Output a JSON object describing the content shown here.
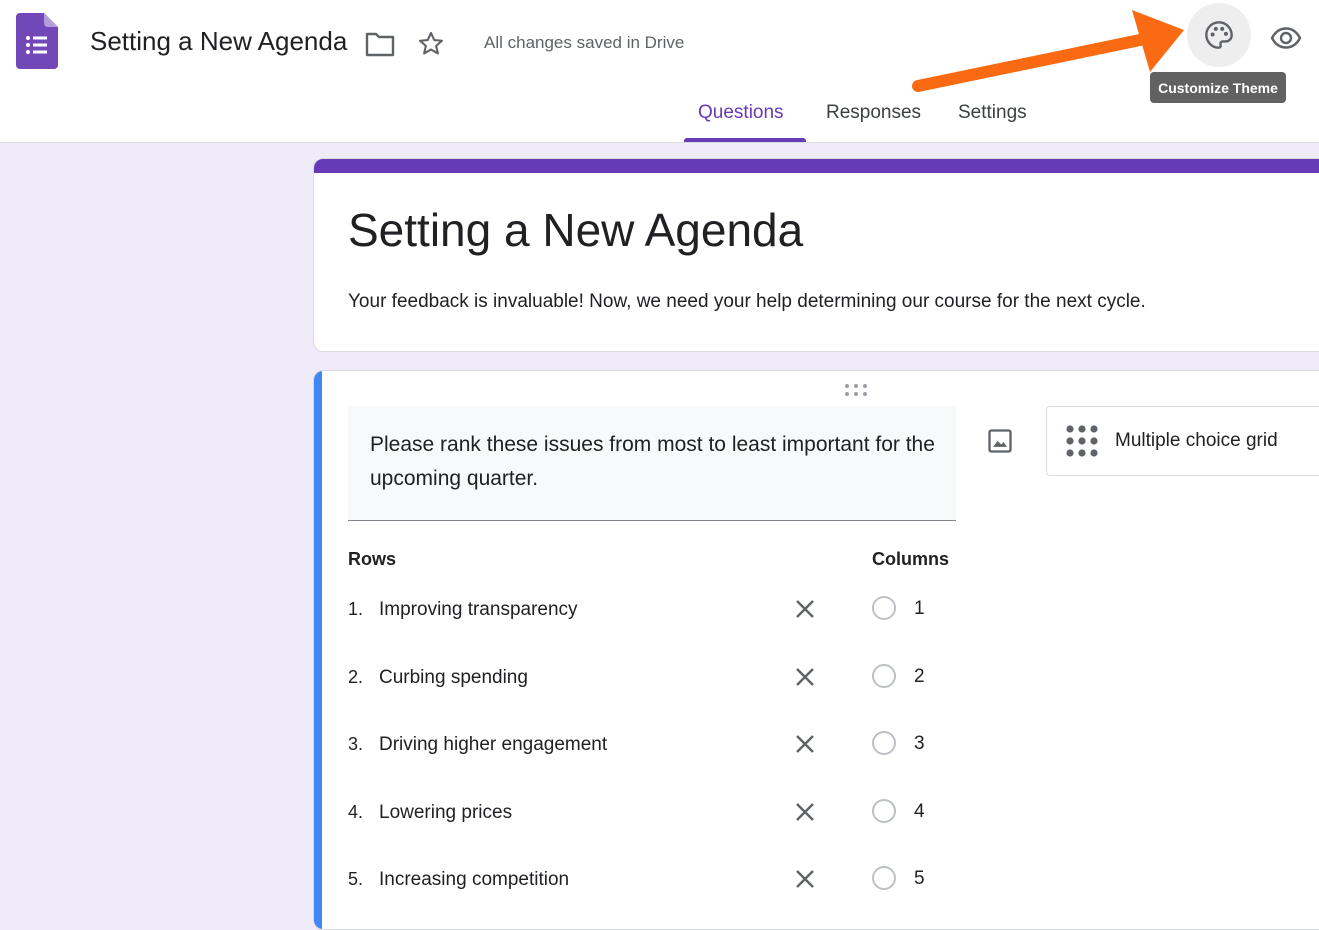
{
  "header": {
    "doc_title": "Setting a New Agenda",
    "save_status": "All changes saved in Drive",
    "tooltip": "Customize Theme",
    "icons": [
      "forms-logo-icon",
      "folder-icon",
      "star-icon",
      "puzzle-icon",
      "palette-icon",
      "eye-icon"
    ]
  },
  "tabs": [
    {
      "label": "Questions",
      "active": true
    },
    {
      "label": "Responses",
      "active": false
    },
    {
      "label": "Settings",
      "active": false
    }
  ],
  "form": {
    "title": "Setting a New Agenda",
    "description": "Your feedback is invaluable! Now, we need your help determining our course for the next cycle."
  },
  "question": {
    "text": "Please rank these issues from most to least important for the upcoming quarter.",
    "type_label": "Multiple choice grid",
    "rows_heading": "Rows",
    "columns_heading": "Columns",
    "rows": [
      {
        "num": "1.",
        "label": "Improving transparency"
      },
      {
        "num": "2.",
        "label": "Curbing spending"
      },
      {
        "num": "3.",
        "label": "Driving higher engagement"
      },
      {
        "num": "4.",
        "label": "Lowering prices"
      },
      {
        "num": "5.",
        "label": "Increasing competition"
      }
    ],
    "columns": [
      {
        "label": "1"
      },
      {
        "label": "2"
      },
      {
        "label": "3"
      },
      {
        "label": "4"
      },
      {
        "label": "5"
      }
    ]
  },
  "colors": {
    "accent": "#673ab7",
    "question_accent": "#4285f4",
    "background": "#f0ebf8",
    "arrow": "#f96a12"
  }
}
